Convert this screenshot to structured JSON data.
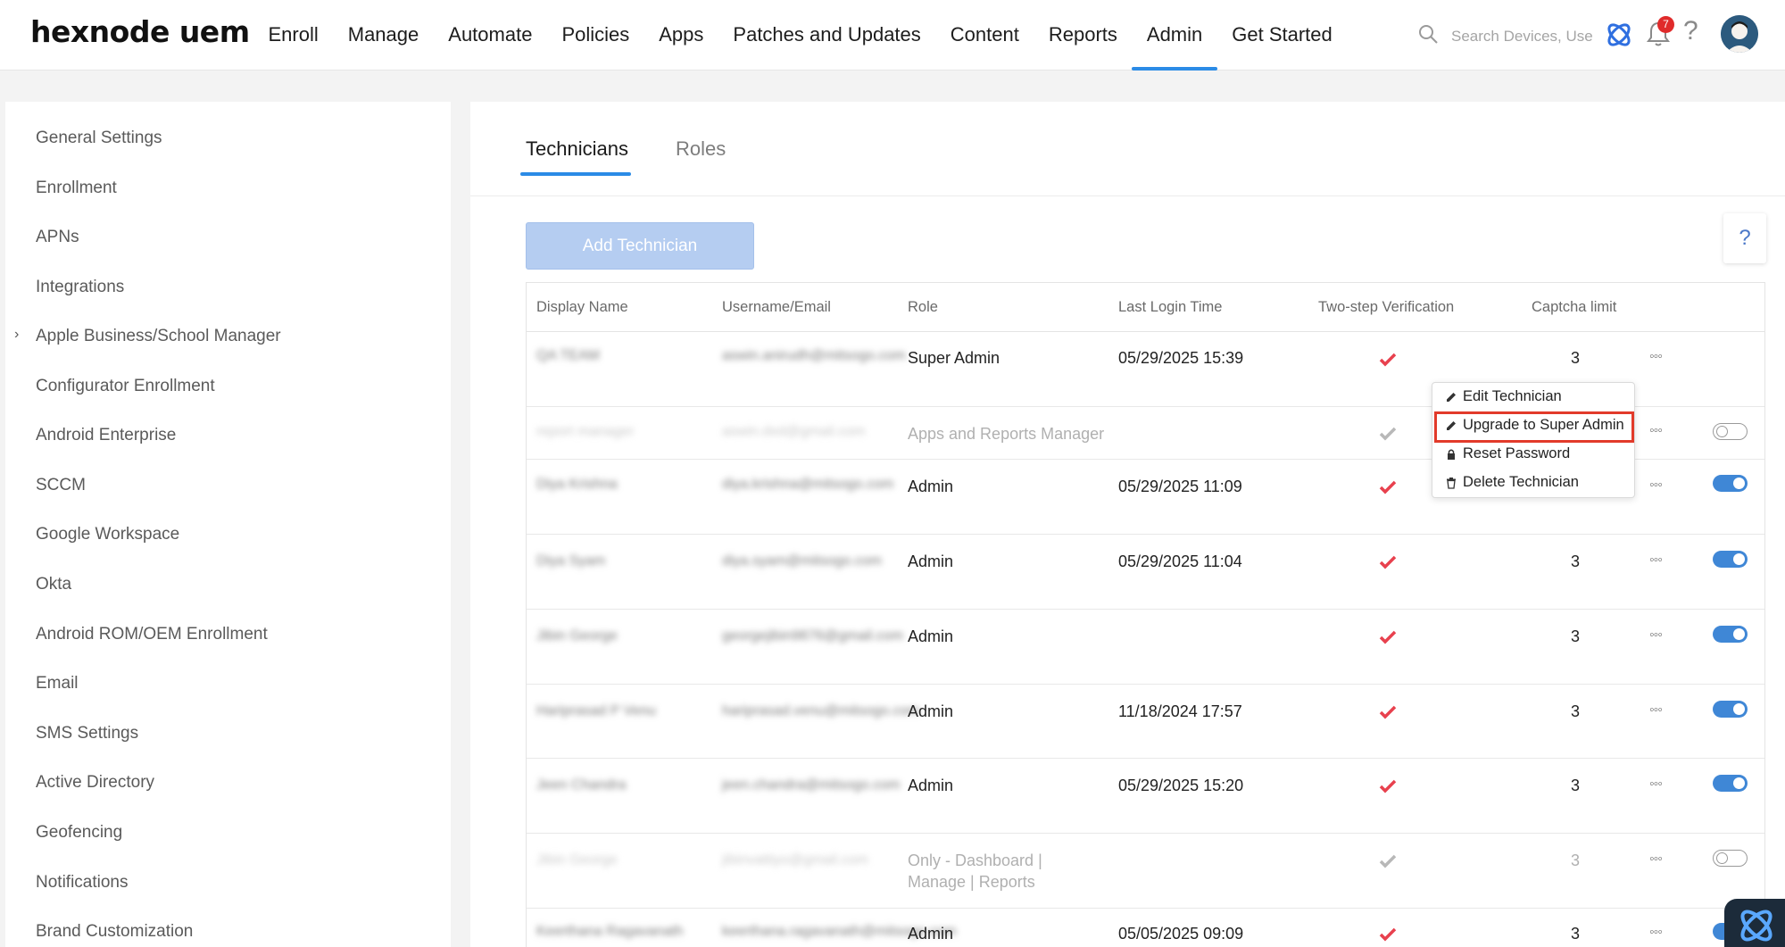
{
  "header": {
    "logo": "hexnode uem",
    "nav": [
      {
        "label": "Enroll",
        "active": false
      },
      {
        "label": "Manage",
        "active": false
      },
      {
        "label": "Automate",
        "active": false
      },
      {
        "label": "Policies",
        "active": false
      },
      {
        "label": "Apps",
        "active": false
      },
      {
        "label": "Patches and Updates",
        "active": false
      },
      {
        "label": "Content",
        "active": false
      },
      {
        "label": "Reports",
        "active": false
      },
      {
        "label": "Admin",
        "active": true
      },
      {
        "label": "Get Started",
        "active": false
      }
    ],
    "search_placeholder": "Search Devices, Use",
    "notification_count": "7",
    "icons": [
      "search-icon",
      "hexnode-app-icon",
      "bell-icon",
      "help-icon",
      "avatar"
    ]
  },
  "sidebar": {
    "items": [
      {
        "label": "General Settings"
      },
      {
        "label": "Enrollment"
      },
      {
        "label": "APNs"
      },
      {
        "label": "Integrations"
      },
      {
        "label": "Apple Business/School Manager",
        "expandable": true
      },
      {
        "label": "Configurator Enrollment"
      },
      {
        "label": "Android Enterprise"
      },
      {
        "label": "SCCM"
      },
      {
        "label": "Google Workspace"
      },
      {
        "label": "Okta"
      },
      {
        "label": "Android ROM/OEM Enrollment"
      },
      {
        "label": "Email"
      },
      {
        "label": "SMS Settings"
      },
      {
        "label": "Active Directory"
      },
      {
        "label": "Geofencing"
      },
      {
        "label": "Notifications"
      },
      {
        "label": "Brand Customization"
      }
    ]
  },
  "main": {
    "tabs": [
      {
        "label": "Technicians",
        "active": true
      },
      {
        "label": "Roles",
        "active": false
      }
    ],
    "add_button": "Add Technician",
    "help_label": "?",
    "table": {
      "columns": [
        "Display Name",
        "Username/Email",
        "Role",
        "Last Login Time",
        "Two-step Verification",
        "Captcha limit"
      ],
      "rows": [
        {
          "name": "QA TEAM",
          "email": "aswin.anirudh@mitsogo.com",
          "role": "Super Admin",
          "last_login": "05/29/2025 15:39",
          "captcha": "3",
          "enabled": null,
          "muted": false
        },
        {
          "name": "report manager",
          "email": "aswin.dxd@gmail.com",
          "role": "Apps and Reports Manager",
          "last_login": "",
          "captcha": "",
          "enabled": false,
          "muted": true
        },
        {
          "name": "Diya Krishna",
          "email": "diya.krishna@mitsogo.com",
          "role": "Admin",
          "last_login": "05/29/2025 11:09",
          "captcha": "",
          "enabled": true,
          "muted": false
        },
        {
          "name": "Diya Syam",
          "email": "diya.syam@mitsogo.com",
          "role": "Admin",
          "last_login": "05/29/2025 11:04",
          "captcha": "3",
          "enabled": true,
          "muted": false
        },
        {
          "name": "Jibin George",
          "email": "georgejibin9876@gmail.com",
          "role": "Admin",
          "last_login": "",
          "captcha": "3",
          "enabled": true,
          "muted": false
        },
        {
          "name": "Hariprasad P Venu",
          "email": "hariprasad.venu@mitsogo.com",
          "role": "Admin",
          "last_login": "11/18/2024 17:57",
          "captcha": "3",
          "enabled": true,
          "muted": false
        },
        {
          "name": "Jeen Chandra",
          "email": "jeen.chandra@mitsogo.com",
          "role": "Admin",
          "last_login": "05/29/2025 15:20",
          "captcha": "3",
          "enabled": true,
          "muted": false
        },
        {
          "name": "Jibin George",
          "email": "jibinvattiyo@gmail.com",
          "role": "Only - Dashboard | Manage | Reports",
          "last_login": "",
          "captcha": "3",
          "enabled": false,
          "muted": true
        },
        {
          "name": "Keerthana Ragavanath",
          "email": "keerthana.ragavanath@mitsogo.com",
          "role": "Admin",
          "last_login": "05/05/2025 09:09",
          "captcha": "3",
          "enabled": true,
          "muted": false
        }
      ]
    },
    "context_menu": {
      "items": [
        {
          "label": "Edit Technician",
          "icon": "pencil-icon"
        },
        {
          "label": "Upgrade to Super Admin",
          "icon": "pencil-icon",
          "highlighted": true
        },
        {
          "label": "Reset Password",
          "icon": "lock-icon"
        },
        {
          "label": "Delete Technician",
          "icon": "trash-icon"
        }
      ]
    }
  },
  "colors": {
    "accent": "#2b8be6",
    "check_red": "#e8414e",
    "check_gray": "#b8b8b8",
    "toggle_on": "#3f87d6",
    "highlight": "#e23a2a"
  }
}
